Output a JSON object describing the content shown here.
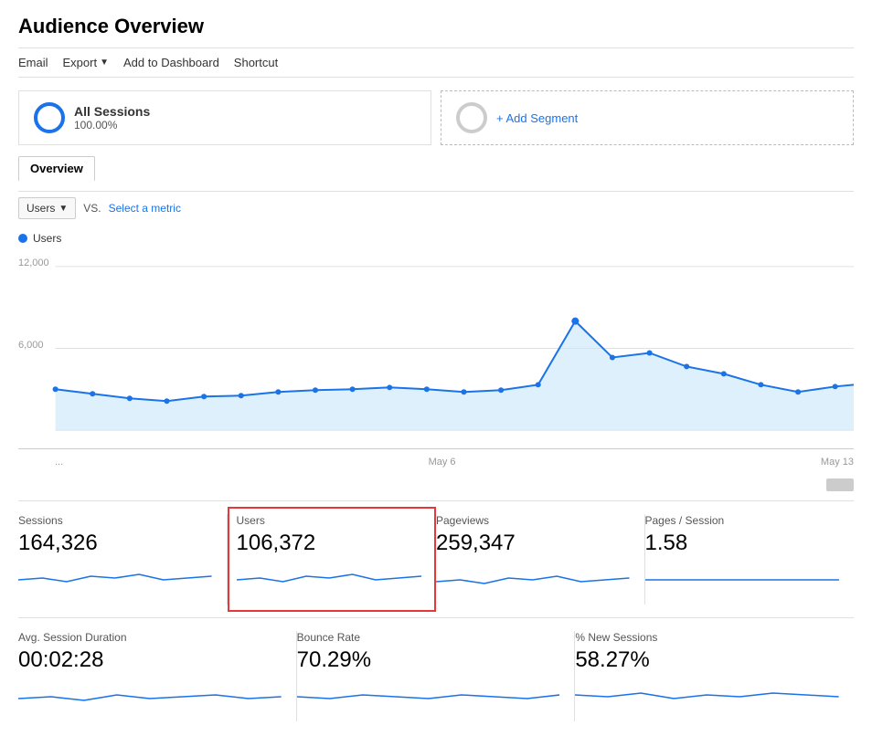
{
  "page": {
    "title": "Audience Overview"
  },
  "toolbar": {
    "email": "Email",
    "export": "Export",
    "add_to_dashboard": "Add to Dashboard",
    "shortcut": "Shortcut"
  },
  "segment": {
    "name": "All Sessions",
    "percent": "100.00%",
    "add_label": "+ Add Segment"
  },
  "overview_tab": "Overview",
  "metric_selector": {
    "primary": "Users",
    "vs_label": "VS.",
    "select_label": "Select a metric"
  },
  "legend": {
    "label": "Users"
  },
  "chart": {
    "y_labels": [
      "12,000",
      "6,000"
    ],
    "x_labels": [
      "...",
      "May 6",
      "May 13"
    ],
    "color": "#1a73e8"
  },
  "stats_row1": [
    {
      "label": "Sessions",
      "value": "164,326",
      "highlighted": false
    },
    {
      "label": "Users",
      "value": "106,372",
      "highlighted": true
    },
    {
      "label": "Pageviews",
      "value": "259,347",
      "highlighted": false
    },
    {
      "label": "Pages / Session",
      "value": "1.58",
      "highlighted": false
    }
  ],
  "stats_row2": [
    {
      "label": "Avg. Session Duration",
      "value": "00:02:28"
    },
    {
      "label": "Bounce Rate",
      "value": "70.29%"
    },
    {
      "label": "% New Sessions",
      "value": "58.27%"
    }
  ]
}
